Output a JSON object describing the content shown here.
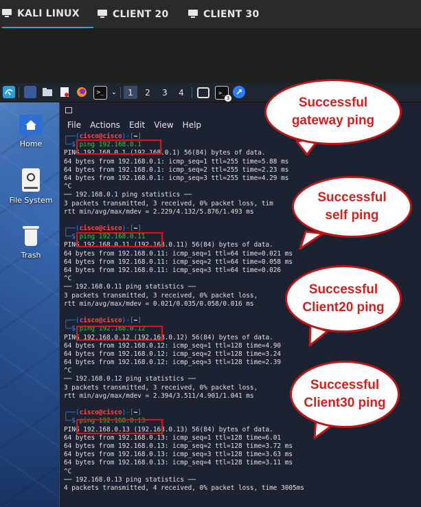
{
  "tabs": [
    {
      "label": "KALI LINUX",
      "active": true
    },
    {
      "label": "CLIENT 20",
      "active": false
    },
    {
      "label": "CLIENT 30",
      "active": false
    }
  ],
  "taskbar": {
    "workspaces": [
      "1",
      "2",
      "3",
      "4"
    ],
    "active_workspace": "1",
    "badge": "3",
    "icons": [
      "kali-menu-icon",
      "show-desktop-icon",
      "file-manager-icon",
      "text-editor-icon",
      "firefox-icon",
      "terminal-icon",
      "screenshot-icon",
      "terminal-alt-icon",
      "browser-icon"
    ]
  },
  "desktop_icons": [
    {
      "label": "Home"
    },
    {
      "label": "File System"
    },
    {
      "label": "Trash"
    }
  ],
  "terminal": {
    "menu": [
      "File",
      "Actions",
      "Edit",
      "View",
      "Help"
    ],
    "prompt": {
      "user": "cisco",
      "at": "@",
      "host": "cisco",
      "dir": "~"
    },
    "blocks": [
      {
        "command": "ping 192.168.0.1",
        "output": [
          "PING 192.168.0.1 (192.168.0.1) 56(84) bytes of data.",
          "64 bytes from 192.168.0.1: icmp_seq=1 ttl=255 time=5.88 ms",
          "64 bytes from 192.168.0.1: icmp_seq=2 ttl=255 time=2.23 ms",
          "64 bytes from 192.168.0.1: icmp_seq=3 ttl=255 time=4.29 ms",
          "^C",
          "── 192.168.0.1 ping statistics ──",
          "3 packets transmitted, 3 received, 0% packet loss, tim",
          "rtt min/avg/max/mdev = 2.229/4.132/5.876/1.493 ms"
        ]
      },
      {
        "command": "ping 192.168.0.11",
        "output": [
          "PING 192.168.0.11 (192.168.0.11) 56(84) bytes of data.",
          "64 bytes from 192.168.0.11: icmp_seq=1 ttl=64 time=0.021 ms",
          "64 bytes from 192.168.0.11: icmp_seq=2 ttl=64 time=0.058 ms",
          "64 bytes from 192.168.0.11: icmp_seq=3 ttl=64 time=0.026",
          "^C",
          "── 192.168.0.11 ping statistics ──",
          "3 packets transmitted, 3 received, 0% packet loss,",
          "rtt min/avg/max/mdev = 0.021/0.035/0.058/0.016 ms"
        ]
      },
      {
        "command": "ping 192.168.0.12",
        "output": [
          "PING 192.168.0.12 (192.168.0.12) 56(84) bytes of data.",
          "64 bytes from 192.168.0.12: icmp_seq=1 ttl=128 time=4.90",
          "64 bytes from 192.168.0.12: icmp_seq=2 ttl=128 time=3.24",
          "64 bytes from 192.168.0.12: icmp_seq=3 ttl=128 time=2.39",
          "^C",
          "── 192.168.0.12 ping statistics ──",
          "3 packets transmitted, 3 received, 0% packet loss,",
          "rtt min/avg/max/mdev = 2.394/3.511/4.901/1.041 ms"
        ]
      },
      {
        "command": "ping 192.168.0.13",
        "output": [
          "PING 192.168.0.13 (192.168.0.13) 56(84) bytes of data.",
          "64 bytes from 192.168.0.13: icmp_seq=1 ttl=128 time=6.01",
          "64 bytes from 192.168.0.13: icmp_seq=2 ttl=128 time=3.72 ms",
          "64 bytes from 192.168.0.13: icmp_seq=3 ttl=128 time=3.63 ms",
          "64 bytes from 192.168.0.13: icmp_seq=4 ttl=128 time=3.11 ms",
          "^C",
          "── 192.168.0.13 ping statistics ──",
          "4 packets transmitted, 4 received, 0% packet loss, time 3005ms"
        ]
      }
    ]
  },
  "callouts": [
    {
      "line1": "Successful",
      "line2": "gateway ping"
    },
    {
      "line1": "Successful",
      "line2": "self ping"
    },
    {
      "line1": "Successful",
      "line2": "Client20 ping"
    },
    {
      "line1": "Successful",
      "line2": "Client30 ping"
    }
  ],
  "colors": {
    "accent": "#2aa6c8",
    "callout_red": "#d41f1f",
    "highlight_box": "#e01414",
    "prompt_blue": "#2a8cff",
    "prompt_user": "#ff4d4d",
    "command_green": "#3fbf3f",
    "terminal_bg": "#1d2232"
  }
}
